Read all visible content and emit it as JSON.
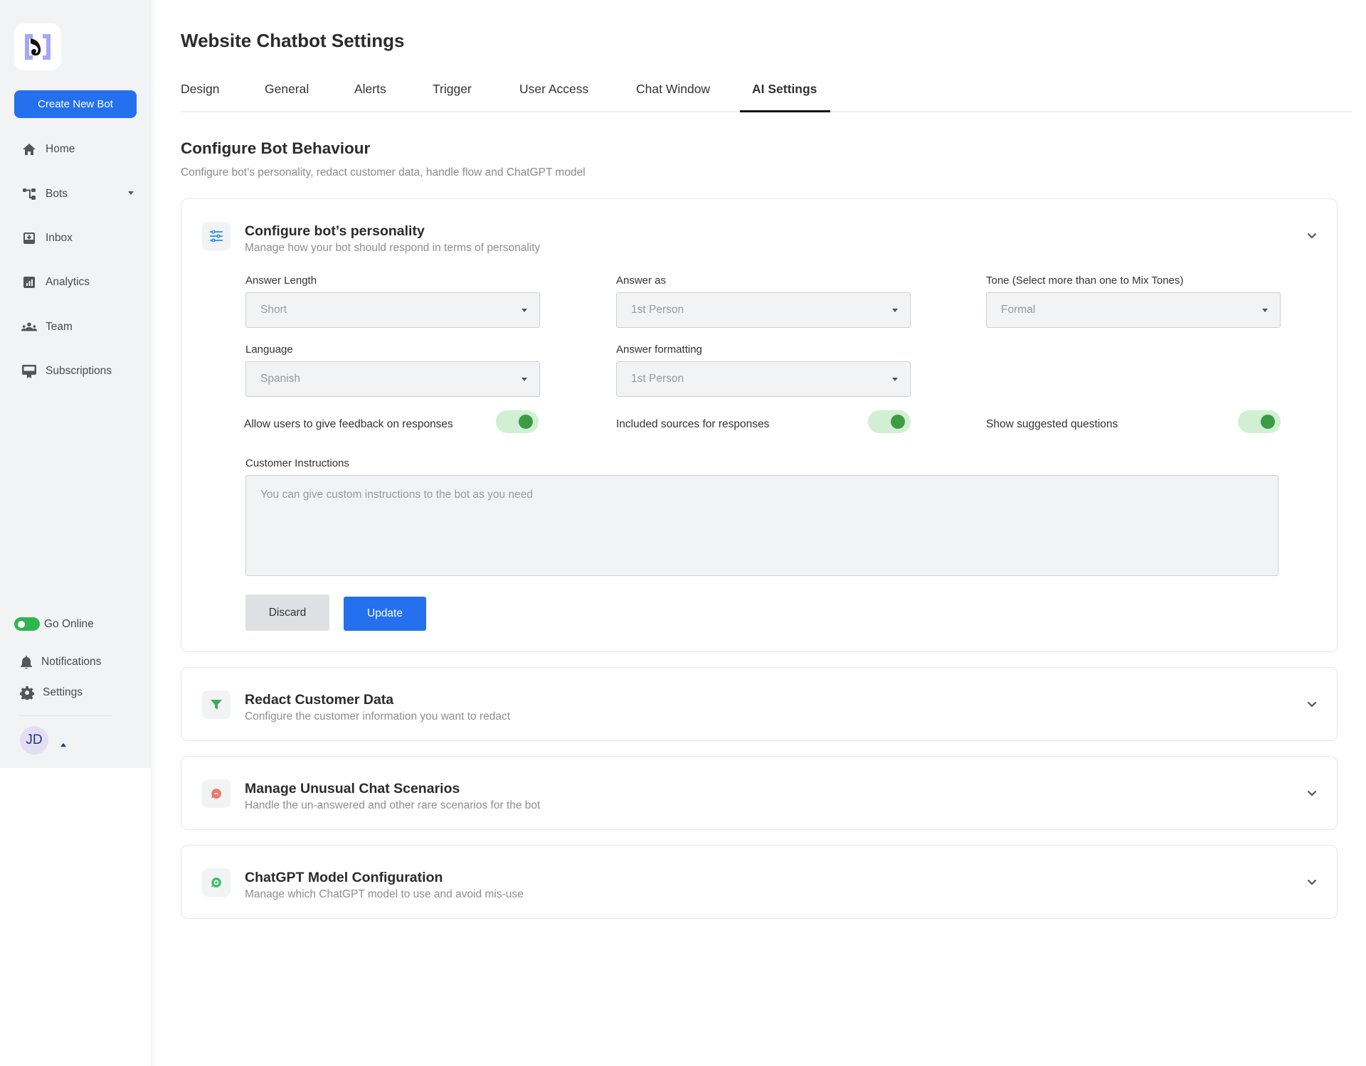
{
  "sidebar": {
    "create_button": "Create New Bot",
    "nav": [
      {
        "label": "Home",
        "icon": "home-icon"
      },
      {
        "label": "Bots",
        "icon": "bots-icon"
      },
      {
        "label": "Inbox",
        "icon": "inbox-icon"
      },
      {
        "label": "Analytics",
        "icon": "analytics-icon"
      },
      {
        "label": "Team",
        "icon": "team-icon"
      },
      {
        "label": "Subscriptions",
        "icon": "subscriptions-icon"
      }
    ],
    "go_online": "Go Online",
    "go_online_on": true,
    "notifications": "Notifications",
    "settings": "Settings",
    "avatar_initials": "JD"
  },
  "header": {
    "title": "Website Chatbot Settings",
    "tabs": [
      "Design",
      "General",
      "Alerts",
      "Trigger",
      "User Access",
      "Chat Window",
      "AI Settings"
    ],
    "active_tab": "AI Settings"
  },
  "section": {
    "title": "Configure Bot Behaviour",
    "subtitle": "Configure bot’s personality, redact customer data, handle flow and ChatGPT model"
  },
  "personality": {
    "title": "Configure bot’s personality",
    "subtitle": "Manage how your bot should respond in terms of personality",
    "fields": {
      "answer_length": {
        "label": "Answer Length",
        "value": "Short"
      },
      "answer_as": {
        "label": "Answer as",
        "value": "1st Person"
      },
      "tone": {
        "label": "Tone (Select more than one to Mix Tones)",
        "value": "Formal"
      },
      "language": {
        "label": "Language",
        "value": "Spanish"
      },
      "answer_formatting": {
        "label": "Answer formatting",
        "value": "1st Person"
      }
    },
    "toggles": [
      {
        "label": "Allow users to give feedback on responses",
        "on": true
      },
      {
        "label": "Included sources for responses",
        "on": true
      },
      {
        "label": "Show suggested questions",
        "on": true
      }
    ],
    "instructions_label": "Customer Instructions",
    "instructions_placeholder": "You can give custom instructions to the bot as you need",
    "discard_label": "Discard",
    "update_label": "Update"
  },
  "cards": [
    {
      "title": "Redact Customer Data",
      "subtitle": "Configure the customer information you want to redact",
      "icon": "filter-icon",
      "color": "#3fae4f"
    },
    {
      "title": "Manage Unusual Chat Scenarios",
      "subtitle": "Handle the un-answered and other rare scenarios for the bot",
      "icon": "chat-bubble-icon",
      "color": "#e87c6a"
    },
    {
      "title": "ChatGPT Model Configuration",
      "subtitle": "Manage which ChatGPT model to use and avoid mis-use",
      "icon": "chatgpt-icon",
      "color": "#3fbf6e"
    }
  ],
  "colors": {
    "accent": "#2470ee",
    "toggle_track": "#d0efd3",
    "toggle_knob": "#3b9c45",
    "online_green": "#2db54e"
  }
}
